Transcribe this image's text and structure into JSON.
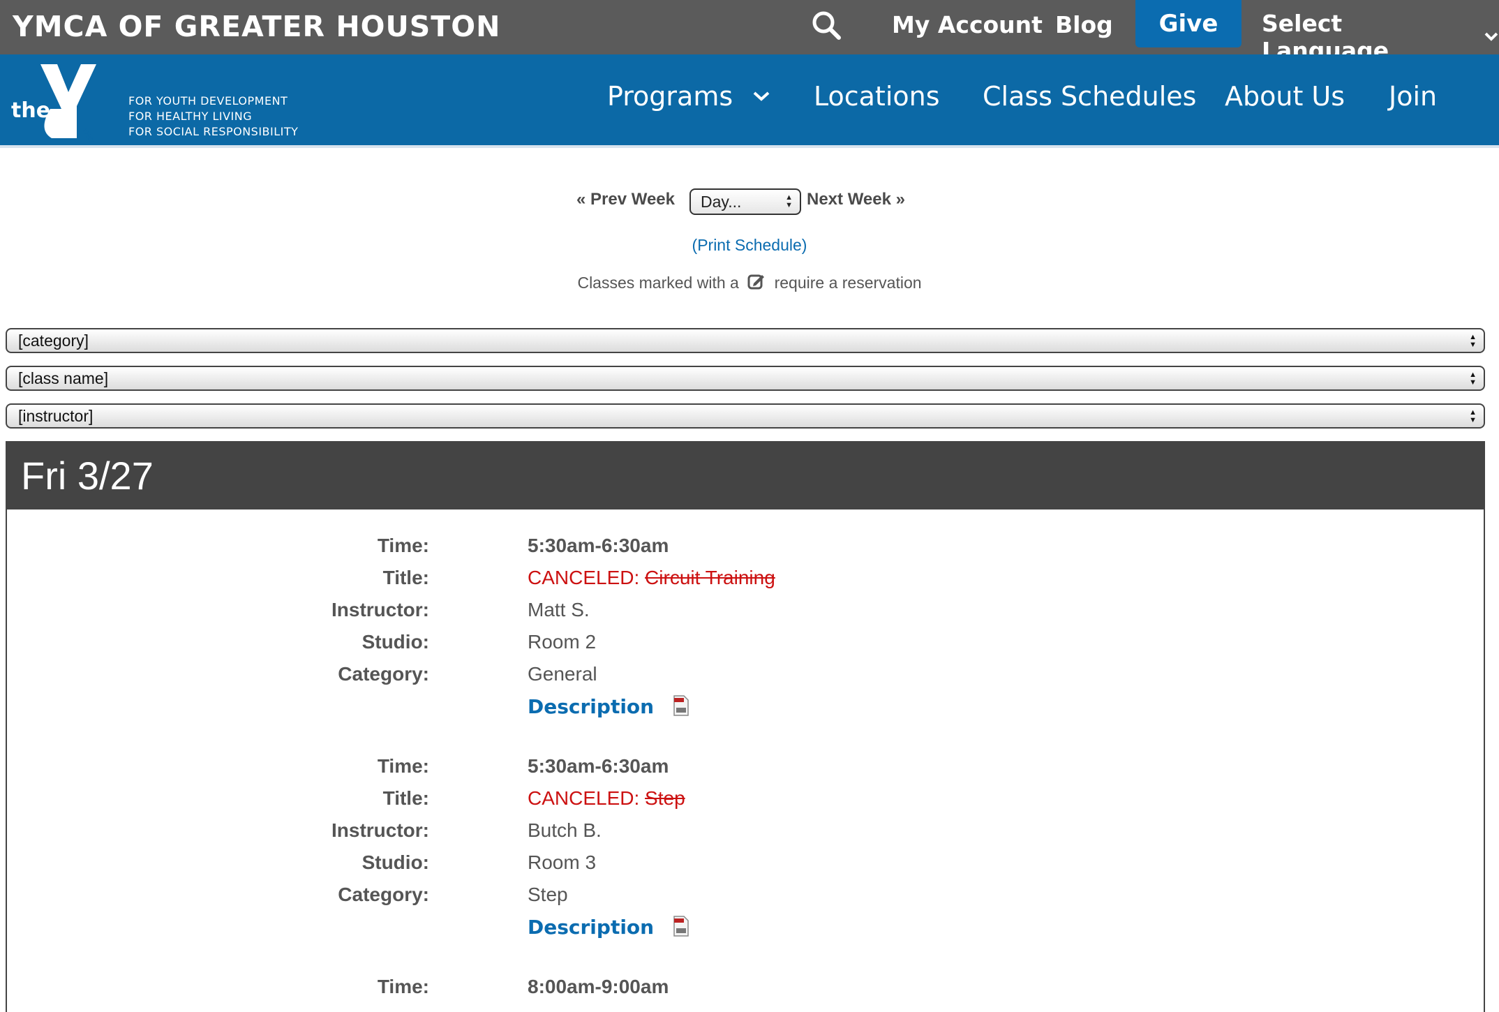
{
  "topbar": {
    "brand": "YMCA OF GREATER HOUSTON",
    "my_account": "My Account",
    "blog": "Blog",
    "give": "Give",
    "language": "Select Language"
  },
  "logo": {
    "the": "the",
    "ymca": "YMCA",
    "tagline": [
      "FOR YOUTH DEVELOPMENT",
      "FOR HEALTHY LIVING",
      "FOR SOCIAL RESPONSIBILITY"
    ]
  },
  "nav": {
    "programs": "Programs",
    "locations": "Locations",
    "class_schedules": "Class Schedules",
    "about_us": "About Us",
    "join": "Join"
  },
  "week": {
    "prev": "« Prev Week",
    "day_select": "Day...",
    "next": "Next Week »",
    "print": "(Print Schedule)",
    "note_before": "Classes marked with a",
    "note_after": "require a reservation"
  },
  "filters": {
    "category": "[category]",
    "class_name": "[class name]",
    "instructor": "[instructor]"
  },
  "schedule": {
    "day": "Fri 3/27",
    "labels": {
      "time": "Time:",
      "title": "Title:",
      "instructor": "Instructor:",
      "studio": "Studio:",
      "category": "Category:"
    },
    "classes": [
      {
        "time": "5:30am-6:30am",
        "canceled_prefix": "CANCELED:",
        "title": "Circuit Training",
        "instructor": "Matt S.",
        "studio": "Room 2",
        "category": "General",
        "description": "Description"
      },
      {
        "time": "5:30am-6:30am",
        "canceled_prefix": "CANCELED:",
        "title": "Step",
        "instructor": "Butch B.",
        "studio": "Room 3",
        "category": "Step",
        "description": "Description"
      },
      {
        "time": "8:00am-9:00am"
      }
    ]
  },
  "colors": {
    "topbar": "#5b5b5b",
    "nav_blue": "#0c69a6",
    "give_blue": "#0b6cb0",
    "day_header": "#444444",
    "canceled_red": "#cc1111"
  }
}
